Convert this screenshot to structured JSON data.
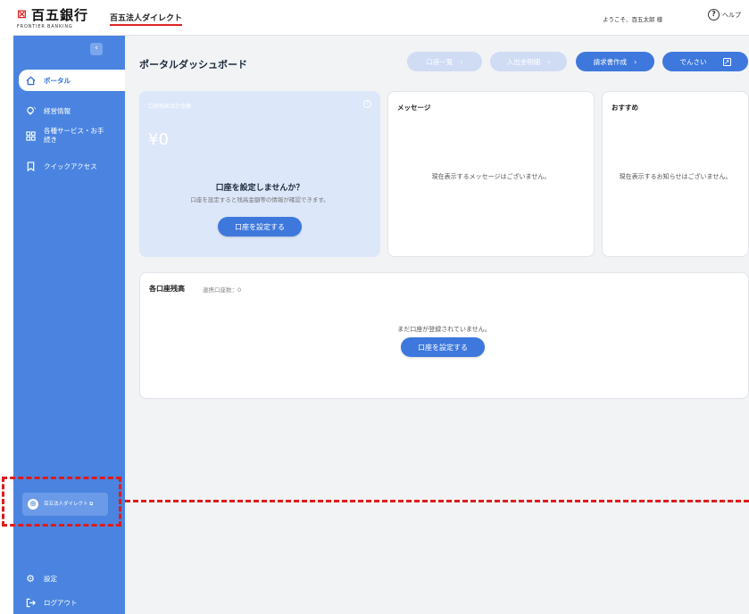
{
  "header": {
    "logo_main": "百五銀行",
    "logo_sub": "FRONTIER BANKING",
    "service_name": "百五法人ダイレクト",
    "welcome": "ようこそ、百五太郎 様",
    "help_label": "ヘルプ"
  },
  "sidebar": {
    "items": [
      {
        "label": "ポータル",
        "icon": "home-icon"
      },
      {
        "label": "経営情報",
        "icon": "bulb-icon"
      },
      {
        "label": "各種サービス・お手続き",
        "icon": "grid-icon"
      },
      {
        "label": "クイックアクセス",
        "icon": "bookmark-icon"
      }
    ],
    "direct_link": "百五法人ダイレクト",
    "settings": "設定",
    "logout": "ログアウト"
  },
  "main": {
    "title": "ポータルダッシュボード",
    "buttons": {
      "account_list": "口座一覧",
      "deposit_details": "入出金明細",
      "invoice": "請求書作成",
      "densai": "でんさい"
    },
    "balance": {
      "label": "口座残高合計金額",
      "amount": "¥0",
      "prompt_title": "口座を設定しませんか？",
      "prompt_desc": "口座を設定すると残高金額等の情報が確認できます。",
      "button": "口座を設定する"
    },
    "messages": {
      "title": "メッセージ",
      "empty": "現在表示するメッセージはございません。"
    },
    "recommend": {
      "title": "おすすめ",
      "empty": "現在表示するお知らせはございません。"
    },
    "accounts": {
      "title": "各口座残高",
      "count": "連携口座数：0",
      "empty": "まだ口座が登録されていません。",
      "button": "口座を設定する"
    }
  },
  "colors": {
    "sidebar": "#4a84e0",
    "primary": "#3e78dd",
    "annotation": "#dd1c1c",
    "brand_red": "#e02424"
  }
}
